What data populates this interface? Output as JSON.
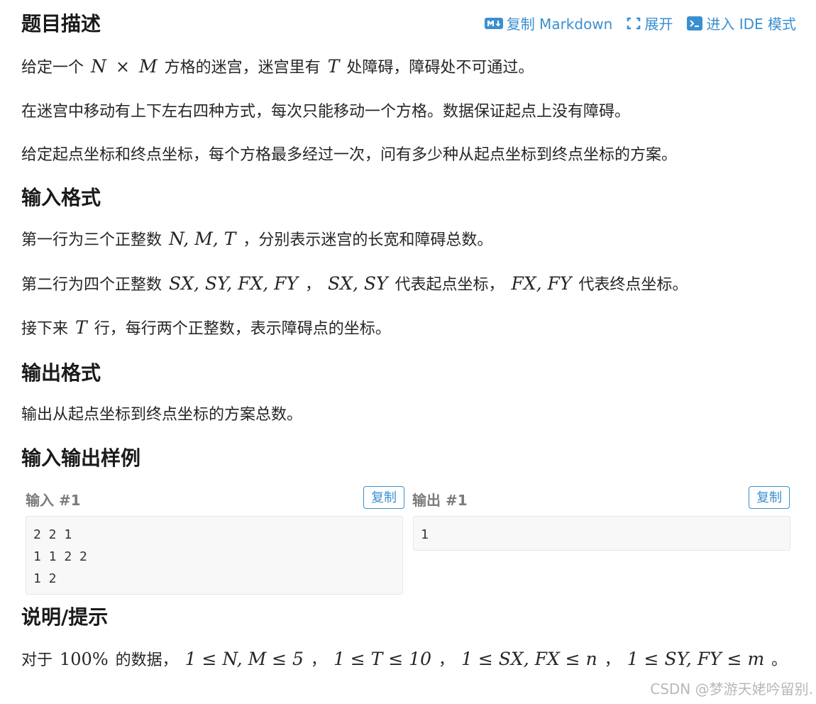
{
  "toolbar": {
    "copy_markdown": "复制 Markdown",
    "expand": "展开",
    "ide_mode": "进入 IDE 模式",
    "icons": [
      "markdown-icon",
      "expand-icon",
      "terminal-icon"
    ]
  },
  "description": {
    "heading": "题目描述",
    "p1": {
      "a": "给定一个",
      "n": "N",
      "times": "×",
      "m": "M",
      "b": "方格的迷宫，迷宫里有",
      "t": "T",
      "c": "处障碍，障碍处不可通过。"
    },
    "p2": "在迷宫中移动有上下左右四种方式，每次只能移动一个方格。数据保证起点上没有障碍。",
    "p3": "给定起点坐标和终点坐标，每个方格最多经过一次，问有多少种从起点坐标到终点坐标的方案。"
  },
  "input_format": {
    "heading": "输入格式",
    "l1": {
      "a": "第一行为三个正整数",
      "math": "N, M, T",
      "b": "，分别表示迷宫的长宽和障碍总数。"
    },
    "l2": {
      "a": "第二行为四个正整数",
      "math1": "SX, SY, FX, FY",
      "b": "，",
      "math2": "SX, SY",
      "c": "代表起点坐标，",
      "math3": "FX, FY",
      "d": "代表终点坐标。"
    },
    "l3": {
      "a": "接下来",
      "t": "T",
      "b": "行，每行两个正整数，表示障碍点的坐标。"
    }
  },
  "output_format": {
    "heading": "输出格式",
    "text": "输出从起点坐标到终点坐标的方案总数。"
  },
  "samples": {
    "heading": "输入输出样例",
    "input_title": "输入 #1",
    "output_title": "输出 #1",
    "copy_label": "复制",
    "input_lines": [
      "2 2 1",
      "1 1 2 2",
      "1 2"
    ],
    "output_lines": [
      "1"
    ]
  },
  "hint": {
    "heading": "说明/提示",
    "a": "对于",
    "pct": "100%",
    "b": "的数据，",
    "m1": "1 ≤ N, M ≤ 5",
    "c": "，",
    "m2": "1 ≤ T ≤ 10",
    "d": "，",
    "m3": "1 ≤ SX, FX ≤ n",
    "e": "，",
    "m4": "1 ≤ SY, FY ≤ m",
    "f": "。"
  },
  "watermark": "CSDN @梦游天姥吟留别.",
  "colors": {
    "accent": "#3b8fd0",
    "code_bg": "#f8f8f8"
  }
}
